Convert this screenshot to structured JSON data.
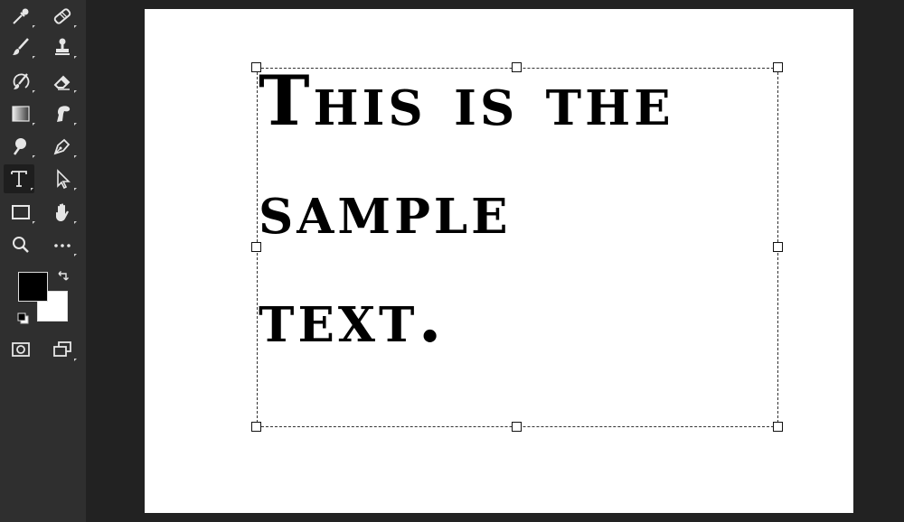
{
  "canvas": {
    "text_lines": [
      "This is the",
      "sample",
      "text."
    ]
  },
  "toolbar": {
    "foreground_color": "#000000",
    "background_color": "#ffffff",
    "tools": [
      {
        "name": "eyedropper-icon"
      },
      {
        "name": "healing-brush-icon"
      },
      {
        "name": "brush-icon"
      },
      {
        "name": "clone-stamp-icon"
      },
      {
        "name": "history-brush-icon"
      },
      {
        "name": "eraser-icon"
      },
      {
        "name": "gradient-icon"
      },
      {
        "name": "smudge-icon"
      },
      {
        "name": "dodge-icon"
      },
      {
        "name": "pen-icon"
      },
      {
        "name": "type-icon",
        "active": true,
        "glyph": "T"
      },
      {
        "name": "path-selection-icon"
      },
      {
        "name": "rectangle-icon"
      },
      {
        "name": "hand-icon"
      },
      {
        "name": "zoom-icon"
      },
      {
        "name": "more-tools-icon",
        "glyph": "•••"
      },
      {
        "name": "quick-mask-icon"
      },
      {
        "name": "screen-mode-icon"
      }
    ]
  }
}
